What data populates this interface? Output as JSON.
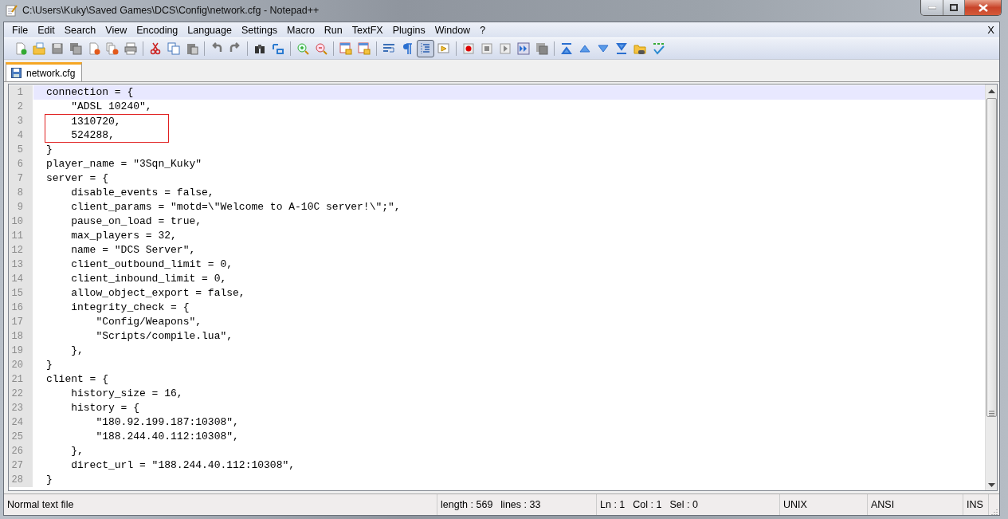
{
  "window": {
    "title": "C:\\Users\\Kuky\\Saved Games\\DCS\\Config\\network.cfg - Notepad++"
  },
  "menu": [
    "File",
    "Edit",
    "Search",
    "View",
    "Encoding",
    "Language",
    "Settings",
    "Macro",
    "Run",
    "TextFX",
    "Plugins",
    "Window",
    "?"
  ],
  "menu_close": "X",
  "toolbar_buttons": [
    {
      "pressed": false
    },
    {
      "pressed": false
    },
    {
      "pressed": false
    },
    {
      "pressed": false
    },
    {
      "pressed": false
    },
    {
      "pressed": false
    },
    {
      "pressed": false
    },
    {
      "pressed": false
    },
    {
      "pressed": false
    },
    {
      "pressed": false
    },
    {
      "pressed": false
    },
    {
      "pressed": false
    },
    {
      "pressed": false
    },
    {
      "pressed": false
    },
    {
      "pressed": false
    },
    {
      "pressed": false
    },
    {
      "pressed": false
    },
    {
      "pressed": false
    },
    {
      "pressed": false
    },
    {
      "pressed": false
    },
    {
      "pressed": true
    },
    {
      "pressed": false
    },
    {
      "pressed": false
    },
    {
      "pressed": false
    },
    {
      "pressed": false
    },
    {
      "pressed": false
    },
    {
      "pressed": false
    },
    {
      "pressed": false
    },
    {
      "pressed": false
    },
    {
      "pressed": false
    },
    {
      "pressed": false
    },
    {
      "pressed": false
    },
    {
      "pressed": false
    }
  ],
  "tabs": [
    {
      "label": "network.cfg",
      "selected": true
    }
  ],
  "lines": [
    {
      "number": "1",
      "text": "connection = {",
      "current": true,
      "boxed": false
    },
    {
      "number": "2",
      "text": "    \"ADSL 10240\",",
      "current": false,
      "boxed": false
    },
    {
      "number": "3",
      "text": "    1310720,",
      "current": false,
      "boxed": true
    },
    {
      "number": "4",
      "text": "    524288,",
      "current": false,
      "boxed": true
    },
    {
      "number": "5",
      "text": "}",
      "current": false,
      "boxed": false
    },
    {
      "number": "6",
      "text": "player_name = \"3Sqn_Kuky\"",
      "current": false,
      "boxed": false
    },
    {
      "number": "7",
      "text": "server = {",
      "current": false,
      "boxed": false
    },
    {
      "number": "8",
      "text": "    disable_events = false,",
      "current": false,
      "boxed": false
    },
    {
      "number": "9",
      "text": "    client_params = \"motd=\\\"Welcome to A-10C server!\\\";\",",
      "current": false,
      "boxed": false
    },
    {
      "number": "10",
      "text": "    pause_on_load = true,",
      "current": false,
      "boxed": false
    },
    {
      "number": "11",
      "text": "    max_players = 32,",
      "current": false,
      "boxed": false
    },
    {
      "number": "12",
      "text": "    name = \"DCS Server\",",
      "current": false,
      "boxed": false
    },
    {
      "number": "13",
      "text": "    client_outbound_limit = 0,",
      "current": false,
      "boxed": false
    },
    {
      "number": "14",
      "text": "    client_inbound_limit = 0,",
      "current": false,
      "boxed": false
    },
    {
      "number": "15",
      "text": "    allow_object_export = false,",
      "current": false,
      "boxed": false
    },
    {
      "number": "16",
      "text": "    integrity_check = {",
      "current": false,
      "boxed": false
    },
    {
      "number": "17",
      "text": "        \"Config/Weapons\",",
      "current": false,
      "boxed": false
    },
    {
      "number": "18",
      "text": "        \"Scripts/compile.lua\",",
      "current": false,
      "boxed": false
    },
    {
      "number": "19",
      "text": "    },",
      "current": false,
      "boxed": false
    },
    {
      "number": "20",
      "text": "}",
      "current": false,
      "boxed": false
    },
    {
      "number": "21",
      "text": "client = {",
      "current": false,
      "boxed": false
    },
    {
      "number": "22",
      "text": "    history_size = 16,",
      "current": false,
      "boxed": false
    },
    {
      "number": "23",
      "text": "    history = {",
      "current": false,
      "boxed": false
    },
    {
      "number": "24",
      "text": "        \"180.92.199.187:10308\",",
      "current": false,
      "boxed": false
    },
    {
      "number": "25",
      "text": "        \"188.244.40.112:10308\",",
      "current": false,
      "boxed": false
    },
    {
      "number": "26",
      "text": "    },",
      "current": false,
      "boxed": false
    },
    {
      "number": "27",
      "text": "    direct_url = \"188.244.40.112:10308\",",
      "current": false,
      "boxed": false
    },
    {
      "number": "28",
      "text": "}",
      "current": false,
      "boxed": false
    }
  ],
  "status_bar": {
    "file_type": "Normal text file",
    "length": "length : 569",
    "lines": "lines : 33",
    "position": [
      "Ln : 1",
      "Col : 1",
      "Sel : 0"
    ],
    "eol": "UNIX",
    "encoding": "ANSI",
    "mode": "INS"
  }
}
